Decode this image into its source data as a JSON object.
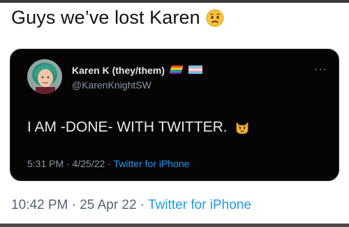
{
  "headline": {
    "text": "Guys we’ve lost Karen",
    "emoji_icon": "worried-face-icon"
  },
  "embedded_tweet": {
    "author_name": "Karen K (they/them)",
    "flags": [
      "rainbow-flag-icon",
      "trans-flag-icon"
    ],
    "handle": "@KarenKnightSW",
    "more_icon": "more-dots-icon",
    "more_label": "···",
    "text": "I AM -DONE- WITH TWITTER.",
    "emoji_icon": "pouting-cat-icon",
    "time": "5:31 PM",
    "date": "4/25/22",
    "source": "Twitter for iPhone"
  },
  "outer_tweet": {
    "time": "10:42 PM",
    "date": "25 Apr 22",
    "source": "Twitter for iPhone"
  },
  "colors": {
    "link": "#1d9bf0",
    "card_background": "#050505",
    "secondary_text": "#8b98a5"
  }
}
